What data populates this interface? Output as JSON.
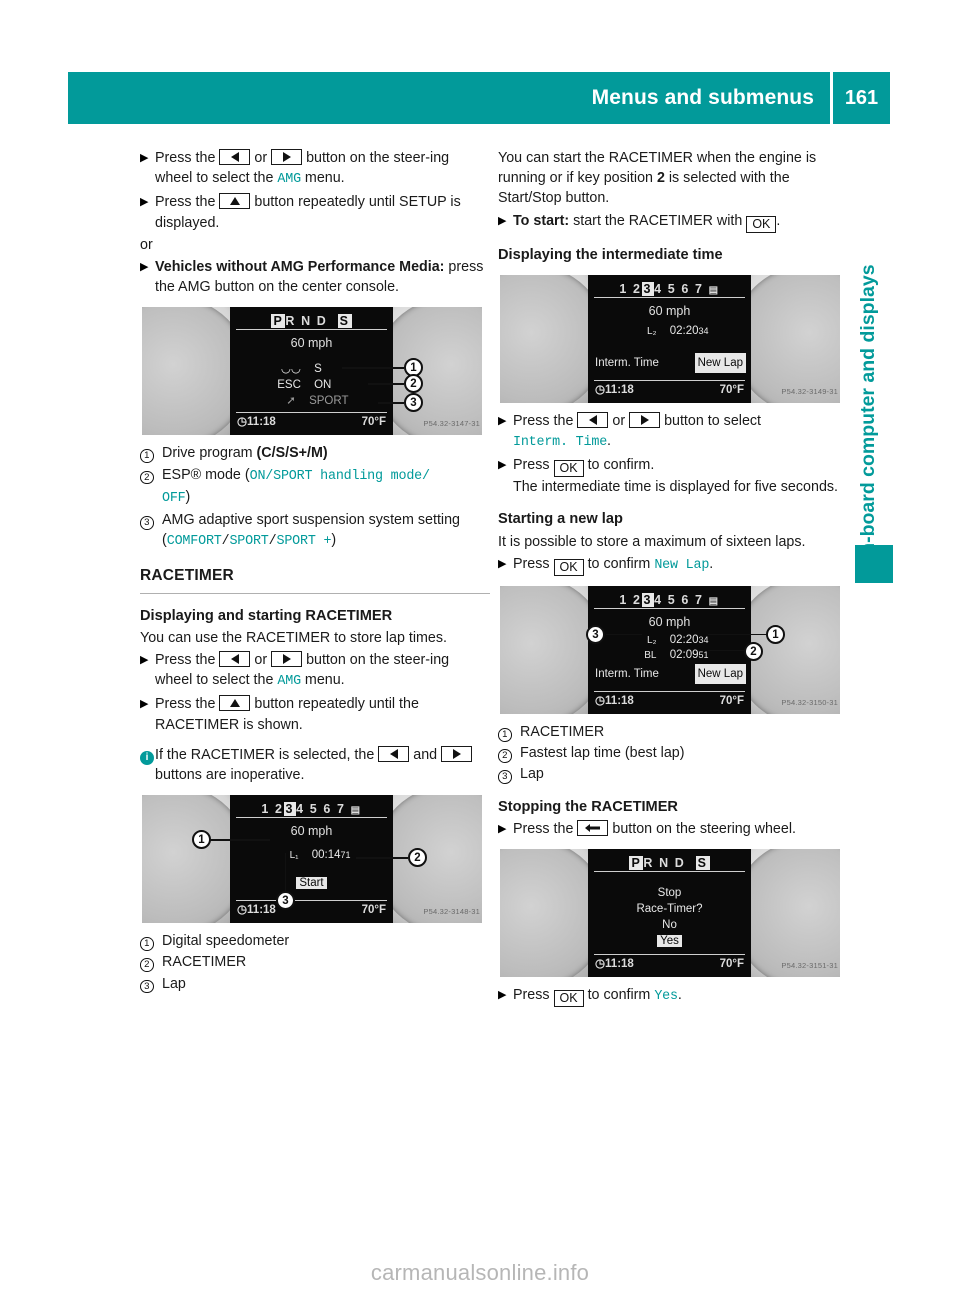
{
  "header": {
    "title": "Menus and submenus",
    "page": "161",
    "accent": "#029a9a"
  },
  "side_tab": {
    "label": "On-board computer and displays"
  },
  "watermark": "carmanualsonline.info",
  "left_column": {
    "step1": {
      "pre": "Press the",
      "mid": "or",
      "post": "button on the steer-ing wheel to select the",
      "menu": "AMG",
      "tail": "menu."
    },
    "step2": {
      "pre": "Press the",
      "post": "button repeatedly until SETUP is displayed."
    },
    "or_label": "or",
    "step3": {
      "bold": "Vehicles without AMG Performance Media:",
      "rest": " press the AMG button on the center console."
    },
    "figure1": {
      "gear_text": "P R N D",
      "gear_boxed": "P",
      "s_boxed": "S",
      "speed": "60 mph",
      "row1": "S",
      "row2_label": "ESC",
      "row2_value": "ON",
      "row3": "SPORT",
      "clock": "11:18",
      "temp": "70°F",
      "code": "P54.32-3147-31",
      "callouts": [
        "1",
        "2",
        "3"
      ]
    },
    "legend1": [
      {
        "num": "1",
        "text": "Drive program ",
        "bold": "(C/S/S+/M)"
      },
      {
        "num": "2",
        "text": "ESP® mode (",
        "values": [
          "ON",
          "SPORT handling mode",
          "OFF"
        ],
        "close": ")"
      },
      {
        "num": "3",
        "text": "AMG adaptive sport suspension system setting (",
        "values": [
          "COMFORT",
          "SPORT",
          "SPORT +"
        ],
        "close": ")"
      }
    ],
    "section_heading": "RACETIMER",
    "sub_heading_1": "Displaying and starting RACETIMER",
    "intro": "You can use the RACETIMER to store lap times.",
    "step4": {
      "pre": "Press the",
      "mid": "or",
      "post": "button on the steer-ing wheel to select the",
      "menu": "AMG",
      "tail": "menu."
    },
    "step5": {
      "pre": "Press the",
      "post": "button repeatedly until the RACETIMER is shown."
    },
    "note": {
      "pre": "If the RACETIMER is selected, the",
      "mid": "and",
      "post": "buttons are inoperative."
    },
    "figure2": {
      "gear_digits": "1 2 3 4 5 6 7",
      "gear_selected": "3",
      "speed": "60 mph",
      "lap_label": "L₁",
      "lap_time": "00:14",
      "lap_hund": "71",
      "start_button": "Start",
      "clock": "11:18",
      "temp": "70°F",
      "code": "P54.32-3148-31",
      "callouts": [
        "1",
        "2",
        "3"
      ]
    },
    "legend2": [
      {
        "num": "1",
        "text": "Digital speedometer"
      },
      {
        "num": "2",
        "text": "RACETIMER"
      },
      {
        "num": "3",
        "text": "Lap"
      }
    ]
  },
  "right_column": {
    "intro": "You can start the RACETIMER when the engine is running or if key position ",
    "intro_bold": "2",
    "intro_tail": " is selected with the Start/Stop button.",
    "step_start": {
      "bold": "To start:",
      "text": " start the RACETIMER with ",
      "key": "OK",
      "tail": "."
    },
    "sub_heading_1": "Displaying the intermediate time",
    "figure1": {
      "gear_digits": "1 2 3 4 5 6 7",
      "gear_selected": "3",
      "speed": "60 mph",
      "lap_label": "L₂",
      "lap_time": "02:20",
      "lap_hund": "34",
      "interm_label": "Interm. Time",
      "newlap_button": "New Lap",
      "clock": "11:18",
      "temp": "70°F",
      "code": "P54.32-3149-31"
    },
    "step1": {
      "pre": "Press the",
      "mid": "or",
      "post": "button to select",
      "value": "Interm. Time",
      "tail": "."
    },
    "step2": {
      "pre": "Press",
      "key": "OK",
      "post": "to confirm.",
      "detail": "The intermediate time is displayed for five seconds."
    },
    "sub_heading_2": "Starting a new lap",
    "intro2": "It is possible to store a maximum of sixteen laps.",
    "step3": {
      "pre": "Press",
      "key": "OK",
      "post": "to confirm ",
      "value": "New Lap",
      "tail": "."
    },
    "figure2": {
      "gear_digits": "1 2 3 4 5 6 7",
      "gear_selected": "3",
      "speed": "60 mph",
      "lap_label": "L₂",
      "lap_time": "02:20",
      "lap_hund": "34",
      "best_label": "BL",
      "best_time": "02:09",
      "best_hund": "51",
      "interm_label": "Interm. Time",
      "newlap_button": "New Lap",
      "clock": "11:18",
      "temp": "70°F",
      "code": "P54.32-3150-31",
      "callouts": [
        "1",
        "2",
        "3"
      ]
    },
    "legend1": [
      {
        "num": "1",
        "text": "RACETIMER"
      },
      {
        "num": "2",
        "text": "Fastest lap time (best lap)"
      },
      {
        "num": "3",
        "text": "Lap"
      }
    ],
    "sub_heading_3": "Stopping the RACETIMER",
    "step4": {
      "pre": "Press the",
      "post": "button on the steering wheel."
    },
    "figure3": {
      "gear_text": "P R N D",
      "gear_boxed": "P",
      "s_boxed": "S",
      "line1": "Stop",
      "line2": "Race-Timer?",
      "line3": "No",
      "line4": "Yes",
      "clock": "11:18",
      "temp": "70°F",
      "code": "P54.32-3151-31"
    },
    "step5": {
      "pre": "Press",
      "key": "OK",
      "post": "to confirm ",
      "value": "Yes",
      "tail": "."
    }
  }
}
